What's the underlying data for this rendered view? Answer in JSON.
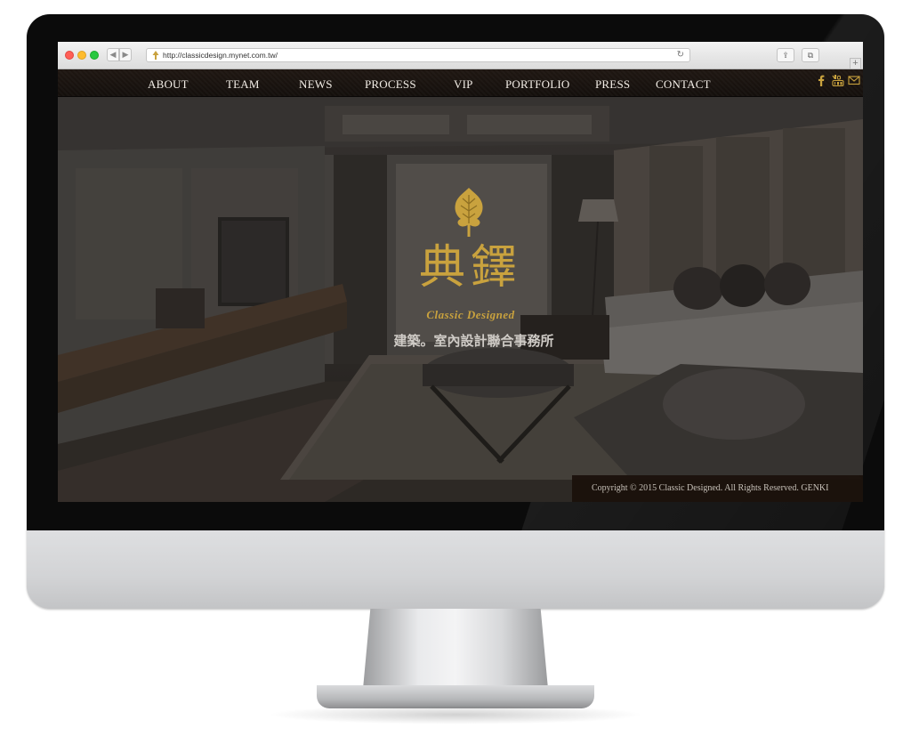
{
  "browser": {
    "url": "http://classicdesign.mynet.com.tw/",
    "back_glyph": "◀",
    "forward_glyph": "▶",
    "reload_glyph": "↻",
    "share_glyph": "⇪",
    "tabs_glyph": "⧉",
    "new_tab_glyph": "+",
    "icons": {
      "favicon": "tree-icon",
      "reload": "reload-icon",
      "share": "share-icon",
      "tabs": "tabs-icon"
    }
  },
  "nav": {
    "items": [
      {
        "label": "ABOUT"
      },
      {
        "label": "TEAM"
      },
      {
        "label": "NEWS"
      },
      {
        "label": "PROCESS"
      },
      {
        "label": "VIP"
      },
      {
        "label": "PORTFOLIO"
      },
      {
        "label": "PRESS"
      },
      {
        "label": "CONTACT"
      }
    ],
    "social": [
      "facebook-icon",
      "youtube-icon",
      "mail-icon"
    ]
  },
  "hero": {
    "logo_chinese": "典鐸",
    "logo_english": "Classic Designed",
    "tagline": "建築。室內設計聯合事務所"
  },
  "footer": {
    "copyright": "Copyright © 2015 Classic Designed. All Rights Reserved. GENKI"
  },
  "colors": {
    "gold": "#c9a23e",
    "nav_bg": "#1a130f",
    "nav_text": "#f2ede6",
    "footer_bg": "#1a100b"
  }
}
